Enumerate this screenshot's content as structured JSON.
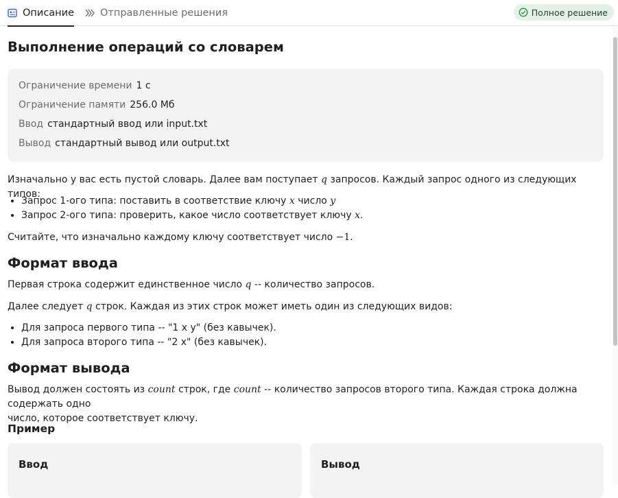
{
  "tabs": {
    "description": "Описание",
    "submissions": "Отправленные решения",
    "status_badge": "Полное решение"
  },
  "problem": {
    "title": "Выполнение операций со словарем",
    "limits": [
      {
        "key": "Ограничение времени",
        "value": "1 с"
      },
      {
        "key": "Ограничение памяти",
        "value": "256.0 Мб"
      },
      {
        "key": "Ввод",
        "value": "стандартный ввод или input.txt"
      },
      {
        "key": "Вывод",
        "value": "стандартный вывод или output.txt"
      }
    ],
    "intro": {
      "a": "Изначально у вас есть пустой словарь. Далее вам поступает ",
      "q": "q",
      "b": " запросов. Каждый запрос одного из следующих типов:"
    },
    "types": [
      {
        "a": "Запрос 1-ого типа: поставить в соответствие ключу ",
        "x": "x",
        "b": " число ",
        "y": "y"
      },
      {
        "a": "Запрос 2-ого типа: проверить, какое число соответствует ключу ",
        "x": "x",
        "b": "."
      }
    ],
    "default_note": {
      "a": "Считайте, что изначально каждому ключу соответствует число ",
      "m": "−1",
      "b": "."
    },
    "input_format": {
      "title": "Формат ввода",
      "line1": {
        "a": "Первая строка содержит единственное число ",
        "q": "q",
        "b": " -- количество запросов."
      },
      "line2": {
        "a": "Далее следует ",
        "q": "q",
        "b": " строк. Каждая из этих строк может иметь один из следующих видов:"
      },
      "items": [
        "Для запроса первого типа -- \"1 x y\" (без кавычек).",
        "Для запроса второго типа -- \"2 x\" (без кавычек)."
      ]
    },
    "output_format": {
      "title": "Формат вывода",
      "a": "Вывод должен состоять из ",
      "m1": "count",
      "b": " строк, где ",
      "m2": "count",
      "c": " -- количество запросов второго типа. Каждая строка должна содержать одно",
      "d": "число, которое соответствует ключу."
    },
    "example": {
      "title": "Пример",
      "input_label": "Ввод",
      "output_label": "Вывод"
    }
  },
  "colors": {
    "accent_tab_icon": "#3b63d6",
    "badge_bg": "#e3f2e6",
    "badge_icon": "#2e8b3d"
  }
}
